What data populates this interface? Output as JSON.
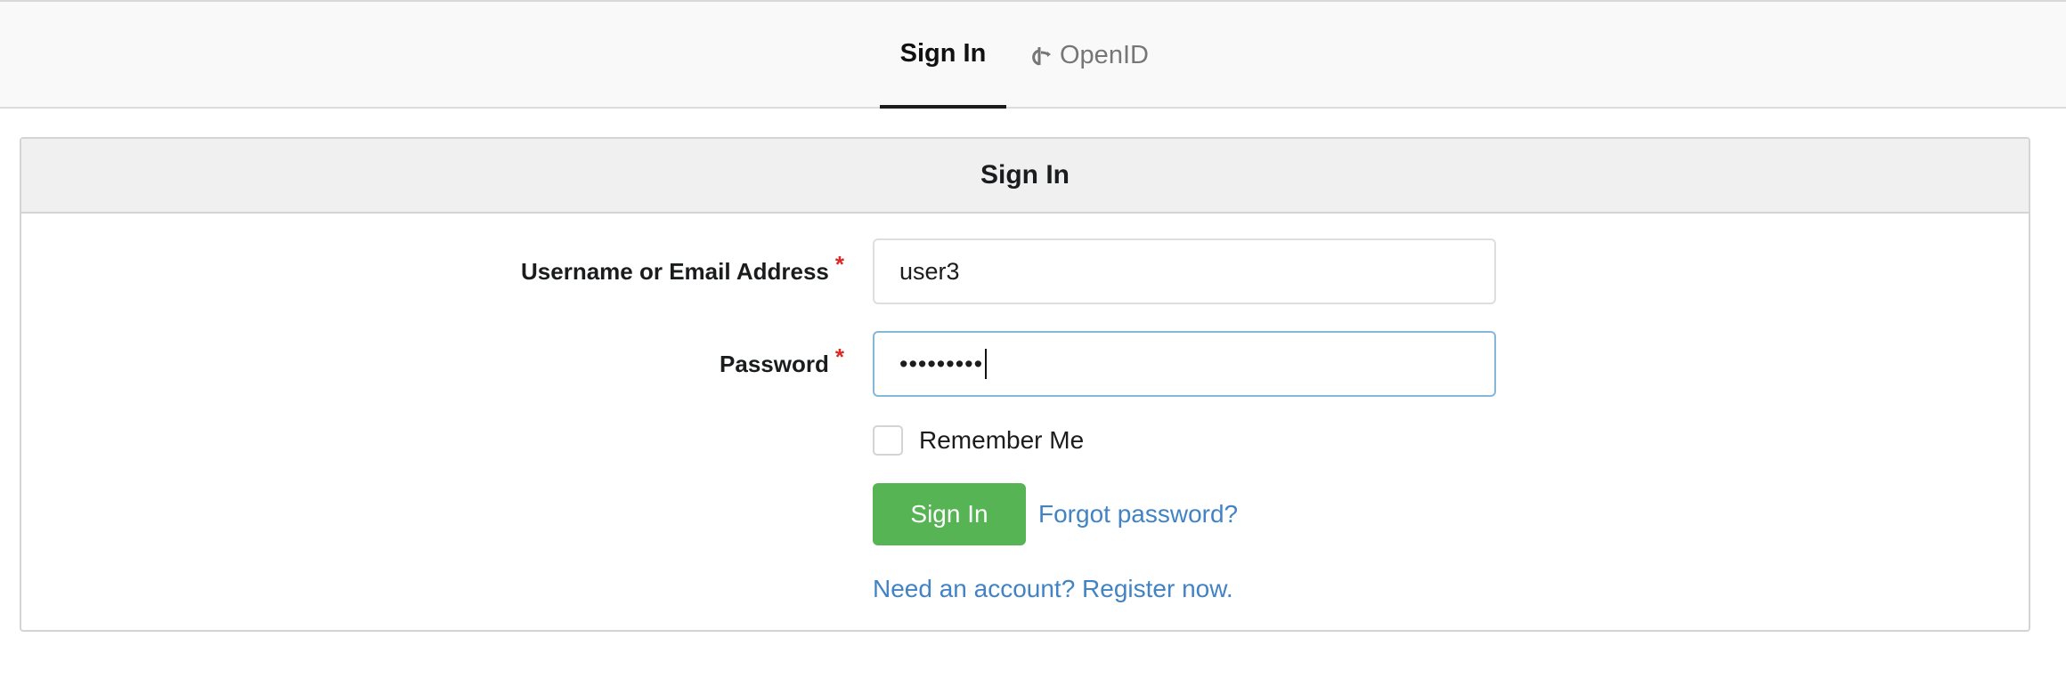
{
  "tabs": {
    "sign_in": "Sign In",
    "openid": "OpenID"
  },
  "panel": {
    "title": "Sign In"
  },
  "form": {
    "username_label": "Username or Email Address",
    "username_value": "user3",
    "password_label": "Password",
    "password_value": "•••••••••",
    "required_marker": "*",
    "remember_label": "Remember Me",
    "remember_checked": false,
    "submit_label": "Sign In",
    "forgot_link": "Forgot password?",
    "register_link": "Need an account? Register now."
  },
  "colors": {
    "accent_green": "#56b454",
    "link_blue": "#4183c4",
    "required_red": "#db2828",
    "focus_border": "#85b7d9"
  }
}
